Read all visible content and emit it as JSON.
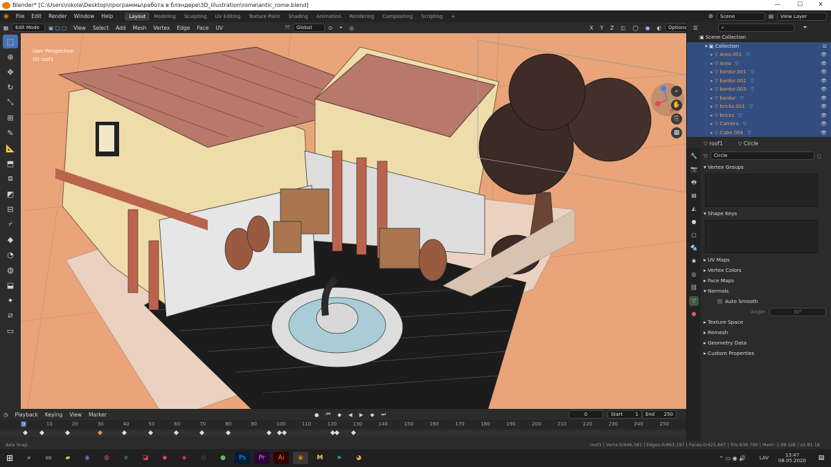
{
  "titlebar": {
    "title": "Blender* [C:\\Users\\nikola\\Desktop\\программы\\работа в блэндере\\3D_illustration\\rome\\antic_rome.blend]",
    "minimize": "—",
    "maximize": "☐",
    "close": "✕"
  },
  "menus": [
    "File",
    "Edit",
    "Render",
    "Window",
    "Help"
  ],
  "workspaces": [
    "Layout",
    "Modeling",
    "Sculpting",
    "UV Editing",
    "Texture Paint",
    "Shading",
    "Animation",
    "Rendering",
    "Compositing",
    "Scripting"
  ],
  "active_workspace": "Layout",
  "scene": "Scene",
  "view_layer": "View Layer",
  "header3d": {
    "mode": "Edit Mode",
    "menus": [
      "View",
      "Select",
      "Add",
      "Mesh",
      "Vertex",
      "Edge",
      "Face",
      "UV"
    ],
    "orientation": "Global",
    "options": "Options",
    "axes": [
      "X",
      "Y",
      "Z"
    ]
  },
  "viewport": {
    "line1": "User Perspective",
    "line2": "(0) roof1"
  },
  "outliner": {
    "root": "Scene Collection",
    "collection": "Collection",
    "items": [
      "Area.001",
      "Area",
      "bardur.001",
      "bardur.002",
      "bardur.003",
      "bardur",
      "bricks.001",
      "bricks",
      "Camera",
      "Cube.004"
    ]
  },
  "props": {
    "object": "roof1",
    "data": "Circle",
    "mesh_field": "Circle",
    "sections": [
      "Vertex Groups",
      "Shape Keys",
      "UV Maps",
      "Vertex Colors",
      "Face Maps",
      "Normals"
    ],
    "auto_smooth": "Auto Smooth",
    "angle_label": "Angle",
    "angle_value": "30°",
    "sections2": [
      "Texture Space",
      "Remesh",
      "Geometry Data",
      "Custom Properties"
    ]
  },
  "timeline": {
    "menus": [
      "Playback",
      "Keying",
      "View",
      "Marker"
    ],
    "current": "0",
    "start_label": "Start",
    "start": "1",
    "end_label": "End",
    "end": "250",
    "ticks": [
      "0",
      "10",
      "20",
      "30",
      "40",
      "50",
      "60",
      "70",
      "80",
      "90",
      "100",
      "110",
      "120",
      "130",
      "140",
      "150",
      "160",
      "170",
      "180",
      "190",
      "200",
      "210",
      "220",
      "230",
      "240",
      "250"
    ]
  },
  "status": {
    "left": "Axis Snap",
    "right": "roof1 | Verts:0/446,381 | Edges:0/863,197 | Faces:0/421,647 | Tris:838,790 | Mem: 1.08 GiB | v2.81.16"
  },
  "taskbar": {
    "lang": "LAV",
    "time": "13:47",
    "date": "08.05.2020"
  },
  "colors": {
    "accent": "#4772b3",
    "selection": "#334d80",
    "viewport_bg": "#e7a073",
    "object_name": "#e6a35a"
  }
}
